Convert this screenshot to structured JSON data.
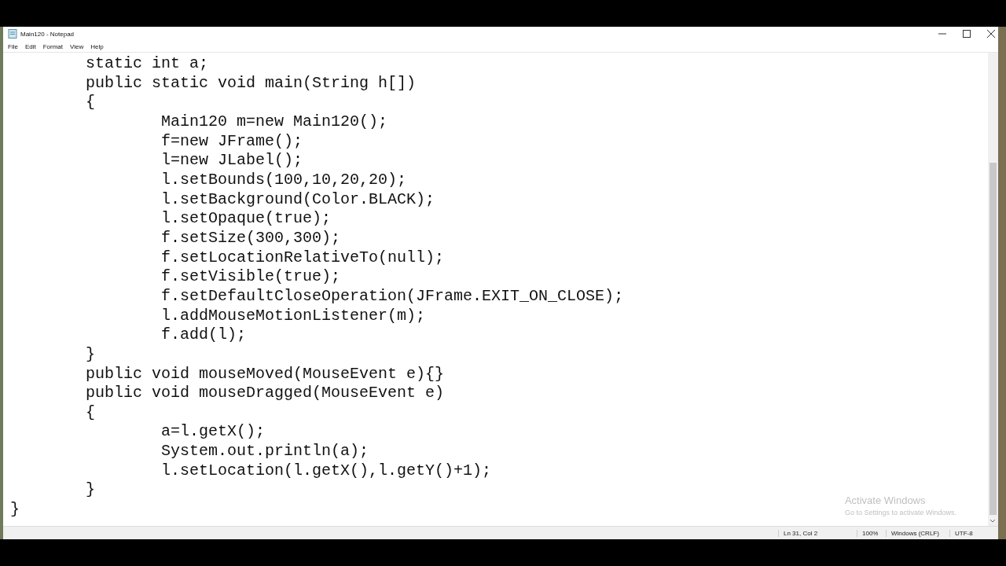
{
  "window": {
    "title": "Main120 - Notepad"
  },
  "menu": [
    "File",
    "Edit",
    "Format",
    "View",
    "Help"
  ],
  "editor": {
    "lines": [
      "\tstatic int a;",
      "\tpublic static void main(String h[])",
      "\t{",
      "\t\tMain120 m=new Main120();",
      "\t\tf=new JFrame();",
      "\t\tl=new JLabel();",
      "\t\tl.setBounds(100,10,20,20);",
      "\t\tl.setBackground(Color.BLACK);",
      "\t\tl.setOpaque(true);",
      "\t\tf.setSize(300,300);",
      "\t\tf.setLocationRelativeTo(null);",
      "\t\tf.setVisible(true);",
      "\t\tf.setDefaultCloseOperation(JFrame.EXIT_ON_CLOSE);",
      "\t\tl.addMouseMotionListener(m);",
      "\t\tf.add(l);",
      "\t}",
      "\tpublic void mouseMoved(MouseEvent e){}",
      "\tpublic void mouseDragged(MouseEvent e)",
      "\t{",
      "\t\ta=l.getX();",
      "\t\tSystem.out.println(a);",
      "\t\tl.setLocation(l.getX(),l.getY()+1);",
      "\t}",
      "}"
    ]
  },
  "activation": {
    "title": "Activate Windows",
    "subtitle": "Go to Settings to activate Windows."
  },
  "status_bar": [
    "Ln 31, Col 2",
    "100%",
    "Windows (CRLF)",
    "UTF-8"
  ]
}
